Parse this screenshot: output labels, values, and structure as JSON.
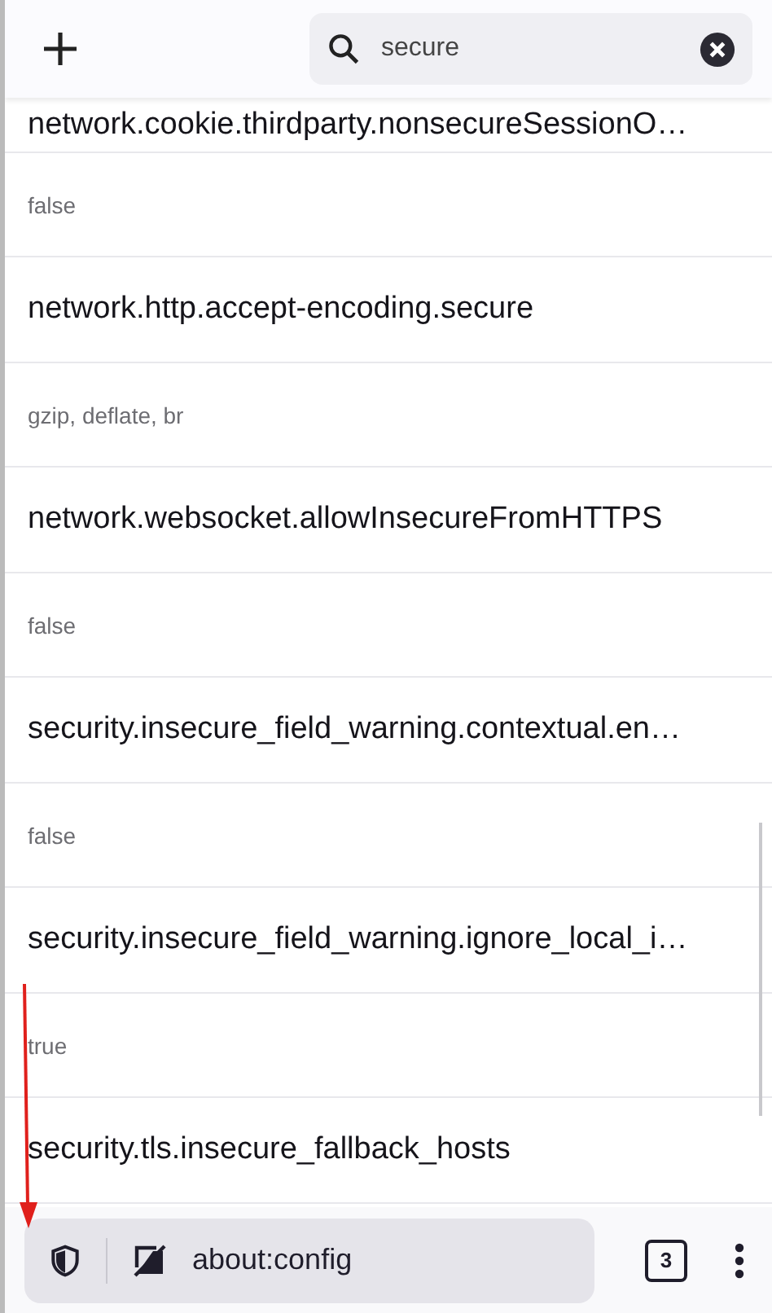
{
  "search": {
    "value": "secure"
  },
  "prefs": [
    {
      "name": "network.cookie.thirdparty.nonsecureSessionO…",
      "value": "false"
    },
    {
      "name": "network.http.accept-encoding.secure",
      "value": "gzip, deflate, br"
    },
    {
      "name": "network.websocket.allowInsecureFromHTTPS",
      "value": "false"
    },
    {
      "name": "security.insecure_field_warning.contextual.en…",
      "value": "false"
    },
    {
      "name": "security.insecure_field_warning.ignore_local_i…",
      "value": "true"
    },
    {
      "name": "security.tls.insecure_fallback_hosts"
    }
  ],
  "toolbar": {
    "url": "about:config",
    "tab_count": "3"
  }
}
